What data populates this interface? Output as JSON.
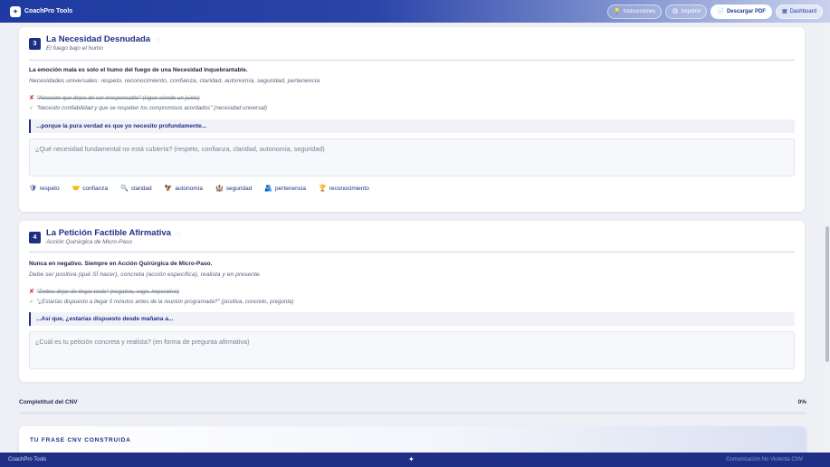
{
  "brand": {
    "name": "CoachPro Tools"
  },
  "toolbar": {
    "instructions": "Instrucciones",
    "print": "Imprimir",
    "pdf": "Descargar PDF",
    "dashboard": "Dashboard"
  },
  "section3": {
    "number": "3",
    "title": "La Necesidad Desnudada",
    "subtitle": "El fuego bajo el humo",
    "intro": "La emoción mala es solo el humo del fuego de una Necesidad Inquebrantable.",
    "universal": "Necesidades universales: respeto, reconocimiento, confianza, claridad, autonomía, seguridad, pertenencia",
    "bad_example": "\"Necesito que dejes de ser irresponsable\" (sigue siendo un juicio)",
    "good_example": "\"Necesito confiabilidad y que se respeten los compromisos acordados\" (necesidad universal)",
    "prompt": "...porque la pura verdad es que yo necesito profundamente...",
    "placeholder": "¿Qué necesidad fundamental no está cubierta? (respeto, confianza, claridad, autonomía, seguridad)",
    "chips": [
      {
        "icon": "🛡",
        "label": "respeto"
      },
      {
        "icon": "🤝",
        "label": "confianza"
      },
      {
        "icon": "🔍",
        "label": "claridad"
      },
      {
        "icon": "🦅",
        "label": "autonomía"
      },
      {
        "icon": "🏰",
        "label": "seguridad"
      },
      {
        "icon": "🫂",
        "label": "pertenencia"
      },
      {
        "icon": "🏆",
        "label": "reconocimiento"
      }
    ]
  },
  "section4": {
    "number": "4",
    "title": "La Petición Factible Afirmativa",
    "subtitle": "Acción Quirúrgica de Micro-Paso",
    "intro": "Nunca en negativo. Siempre en Acción Quirúrgica de Micro-Paso.",
    "rule": "Debe ser positiva (qué SÍ hacer), concreta (acción específica), realista y en presente.",
    "bad_example": "\"Debes dejar de llegar tarde\" (negativo, vago, imperativo)",
    "good_example": "\"¿Estarías dispuesto a llegar 5 minutos antes de la reunión programada?\" (positiva, concreto, pregunta)",
    "prompt": "...Así que, ¿estarías dispuesto desde mañana a...",
    "placeholder": "¿Cuál es tu petición concreta y realista? (en forma de pregunta afirmativa)"
  },
  "progress": {
    "label": "Completitud del CNV",
    "value_text": "0%",
    "value": 0
  },
  "sentence": {
    "label": "TU FRASE CNV CONSTRUIDA"
  },
  "footer": {
    "left": "CoachPro Tools",
    "right": "Comunicación No Violenta CNV"
  }
}
